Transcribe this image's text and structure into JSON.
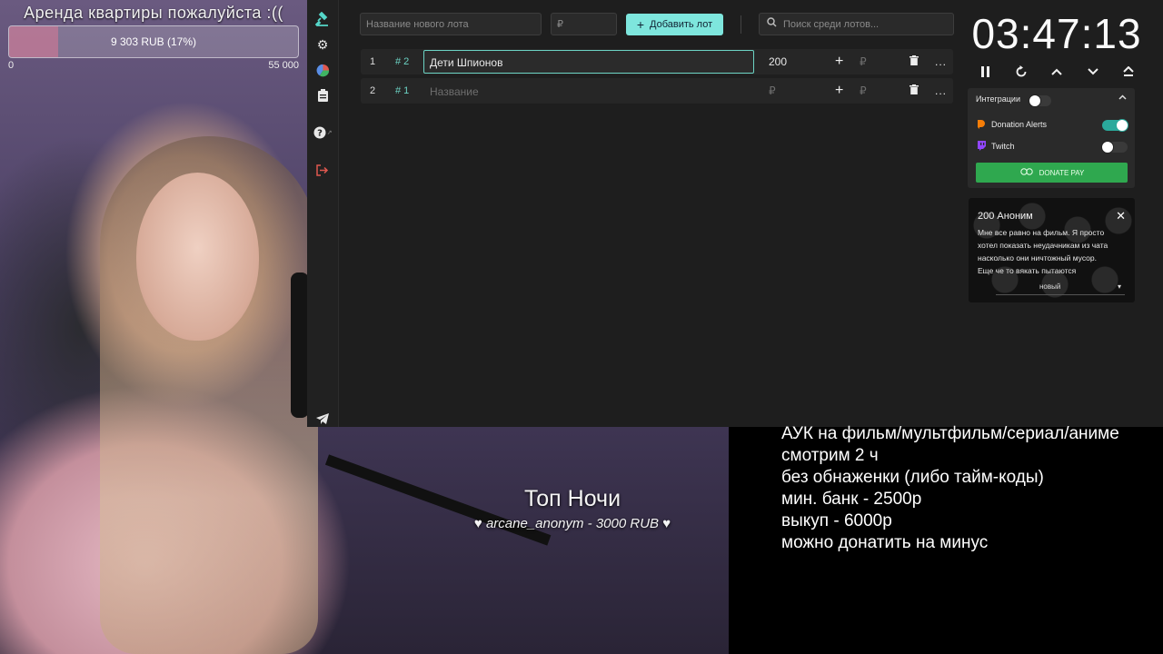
{
  "goal": {
    "title": "Аренда квартиры пожалуйста :((",
    "bar_text": "9 303 RUB (17%)",
    "progress_percent": 17,
    "min_label": "0",
    "max_label": "55 000"
  },
  "sidebar": {
    "icons": [
      "gavel-icon",
      "gear-icon",
      "pie-chart-icon",
      "clipboard-icon",
      "help-icon",
      "logout-icon",
      "telegram-icon"
    ],
    "help_sup": "↗"
  },
  "toolbar": {
    "new_lot_placeholder": "Название нового лота",
    "amount_placeholder": "₽",
    "add_label": "Добавить лот",
    "add_icon": "+",
    "search_placeholder": "Поиск среди лотов..."
  },
  "lots": [
    {
      "num": "1",
      "tag": "# 2",
      "name": "Дети Шпионов",
      "amount": "200",
      "plus": "+",
      "rub": "₽",
      "del": "🗑",
      "more": "..."
    },
    {
      "num": "2",
      "tag": "# 1",
      "name": "Название",
      "amount": "₽",
      "plus": "+",
      "rub": "₽",
      "del": "🗑",
      "more": "..."
    }
  ],
  "timer": {
    "value": "03:47:13",
    "controls": [
      "pause-icon",
      "reset-icon",
      "chevron-up-icon",
      "chevron-down-icon",
      "eject-icon"
    ]
  },
  "integrations": {
    "title": "Интеграции",
    "title_toggle_on": false,
    "items": [
      {
        "name": "Donation Alerts",
        "on": true,
        "color": "#f57d07"
      },
      {
        "name": "Twitch",
        "on": false,
        "color": "#9146ff"
      }
    ],
    "donatepay_label": "DONATE PAY"
  },
  "donation": {
    "title": "200 Аноним",
    "message_lines": [
      "Мне все равно на фильм. Я просто",
      "хотел показать неудачникам из чата",
      "насколько они ничтожный мусор.",
      "Еще че то вякать пытаются"
    ],
    "status": "новый"
  },
  "top_night": {
    "title": "Топ Ночи",
    "entry": "arcane_anonym - 3000 RUB",
    "heart": "♥"
  },
  "rules": [
    "АУК на фильм/мультфильм/сериал/аниме",
    "смотрим 2 ч",
    "без обнаженки (либо тайм-коды)",
    "мин. банк - 2500р",
    "выкуп - 6000р",
    "можно донатить на минус"
  ],
  "colors": {
    "accent": "#7ee6dd",
    "teal": "#6cd3c4",
    "danger": "#e0584f",
    "donatepay": "#2fa84f"
  }
}
